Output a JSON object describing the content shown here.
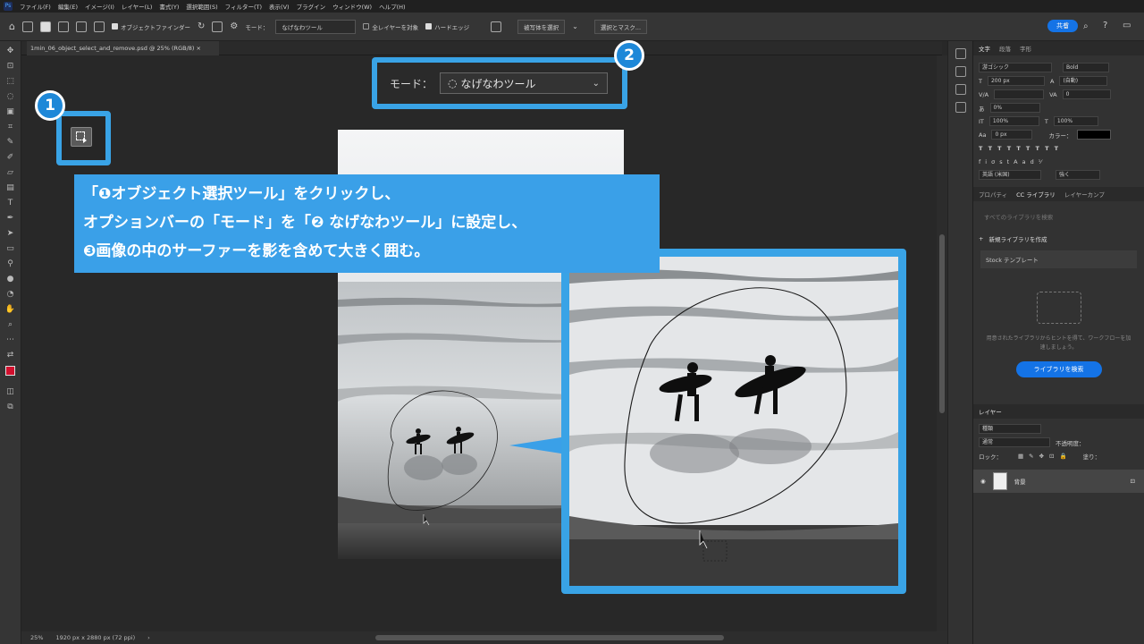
{
  "menu": [
    "ファイル(F)",
    "編集(E)",
    "イメージ(I)",
    "レイヤー(L)",
    "書式(Y)",
    "選択範囲(S)",
    "フィルター(T)",
    "表示(V)",
    "プラグイン",
    "ウィンドウ(W)",
    "ヘルプ(H)"
  ],
  "options": {
    "object_finder": "オブジェクトファインダー",
    "mode_label": "モード：",
    "mode_value": "なげなわツール",
    "all_layers": "全レイヤーを対象",
    "hard_edge": "ハードエッジ",
    "select_subject": "被写体を選択",
    "select_mask": "選択とマスク...",
    "share": "共有"
  },
  "document": {
    "tab": "1min_06_object_select_and_remove.psd @ 25% (RGB/8)",
    "zoom": "25%",
    "size": "1920 px x 2880 px (72 ppi)"
  },
  "callouts": {
    "badge1": "1",
    "badge2": "2",
    "mode_label": "モード：",
    "mode_value": "なげなわツール",
    "line1": "「❶オブジェクト選択ツール」をクリックし、",
    "line2": "オプションバーの「モード」を「❷ なげなわツール」に設定し、",
    "line3": "❸画像の中のサーファーを影を含めて大きく囲む。"
  },
  "panels": {
    "char_tabs": [
      "文字",
      "段落",
      "字形"
    ],
    "font": "游ゴシック",
    "weight": "Bold",
    "size": "200 px",
    "leading": "(自動)",
    "tracking": "0",
    "scale": "0%",
    "vscale": "100%",
    "hscale": "100%",
    "baseline": "0 px",
    "color_label": "カラー：",
    "lang": "英語 (米国)",
    "aa": "強く",
    "lib_tabs": [
      "プロパティ",
      "CC ライブラリ",
      "レイヤーカンプ"
    ],
    "lib_search": "すべてのライブラリを検索",
    "new_lib": "新規ライブラリを作成",
    "stock": "Stock テンプレート",
    "lib_hint": "用意されたライブラリからヒントを得て、ワークフローを加速しましょう。",
    "lib_btn": "ライブラリを検索",
    "layers_tab": "レイヤー",
    "layers_search": "種類",
    "blend": "通常",
    "opacity": "不透明度：",
    "lock": "ロック：",
    "fill": "塗り：",
    "layer_name": "背景"
  }
}
